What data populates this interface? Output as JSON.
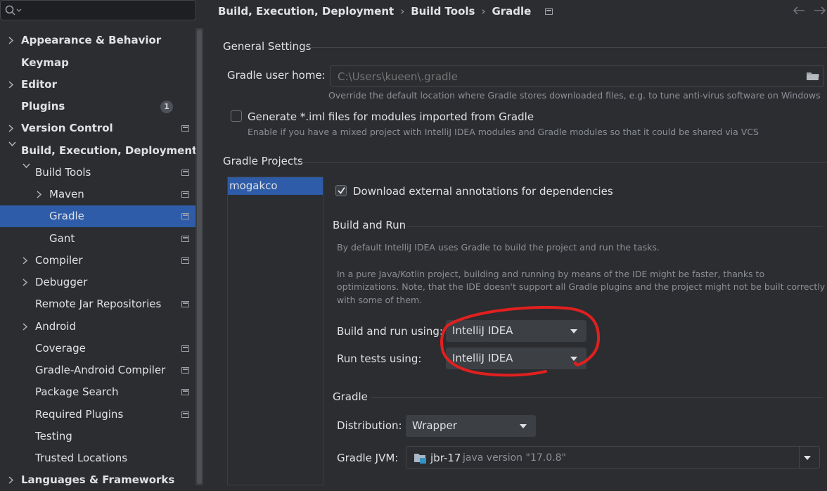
{
  "breadcrumb": [
    "Build, Execution, Deployment",
    "Build Tools",
    "Gradle"
  ],
  "sidebar": {
    "items": [
      {
        "label": "Appearance & Behavior"
      },
      {
        "label": "Keymap"
      },
      {
        "label": "Editor"
      },
      {
        "label": "Plugins",
        "badge": "1"
      },
      {
        "label": "Version Control"
      },
      {
        "label": "Build, Execution, Deployment"
      },
      {
        "label": "Build Tools"
      },
      {
        "label": "Maven"
      },
      {
        "label": "Gradle"
      },
      {
        "label": "Gant"
      },
      {
        "label": "Compiler"
      },
      {
        "label": "Debugger"
      },
      {
        "label": "Remote Jar Repositories"
      },
      {
        "label": "Android"
      },
      {
        "label": "Coverage"
      },
      {
        "label": "Gradle-Android Compiler"
      },
      {
        "label": "Package Search"
      },
      {
        "label": "Required Plugins"
      },
      {
        "label": "Testing"
      },
      {
        "label": "Trusted Locations"
      },
      {
        "label": "Languages & Frameworks"
      }
    ]
  },
  "general": {
    "title": "General Settings",
    "user_home_label": "Gradle user home:",
    "user_home_placeholder": "C:\\Users\\kueen\\.gradle",
    "user_home_hint": "Override the default location where Gradle stores downloaded files, e.g. to tune anti-virus software on Windows",
    "iml_label": "Generate *.iml files for modules imported from Gradle",
    "iml_hint": "Enable if you have a mixed project with IntelliJ IDEA modules and Gradle modules so that it could be shared via VCS"
  },
  "projects": {
    "title": "Gradle Projects",
    "list": [
      "mogakco"
    ],
    "download_annotations_label": "Download external annotations for dependencies"
  },
  "build_run": {
    "title": "Build and Run",
    "desc1": "By default IntelliJ IDEA uses Gradle to build the project and run the tasks.",
    "desc2_line1": "In a pure Java/Kotlin project, building and running by means of the IDE might be faster, thanks to",
    "desc2_line2": "optimizations. Note, that the IDE doesn't support all Gradle plugins and the project might not be built correctly",
    "desc2_line3": "with some of them.",
    "build_using_label": "Build and run using:",
    "build_using_value": "IntelliJ IDEA",
    "tests_using_label": "Run tests using:",
    "tests_using_value": "IntelliJ IDEA"
  },
  "gradle": {
    "title": "Gradle",
    "distribution_label": "Distribution:",
    "distribution_value": "Wrapper",
    "jvm_label": "Gradle JVM:",
    "jvm_name": "jbr-17",
    "jvm_version": "java version \"17.0.8\""
  },
  "colors": {
    "selection": "#2e5ca8",
    "annotation": "#e0201f"
  }
}
